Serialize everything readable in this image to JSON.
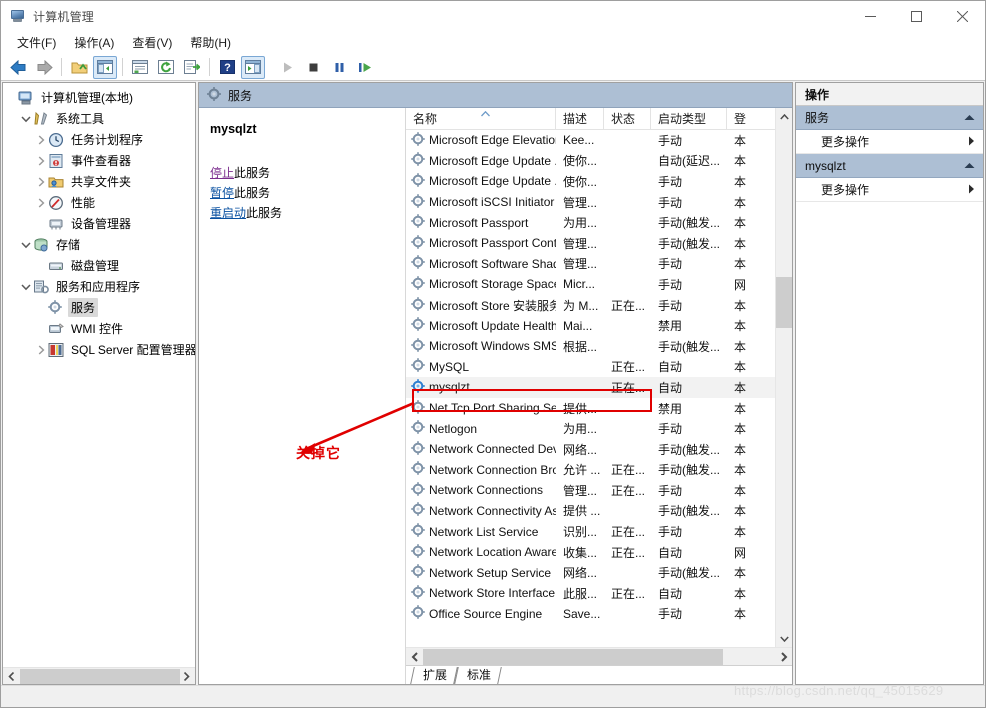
{
  "window": {
    "title": "计算机管理",
    "icon": "computer-management-icon",
    "minimize_label": "最小化",
    "maximize_label": "最大化",
    "close_label": "关闭"
  },
  "menubar": {
    "items": [
      {
        "label": "文件(F)",
        "name": "menu-file"
      },
      {
        "label": "操作(A)",
        "name": "menu-action"
      },
      {
        "label": "查看(V)",
        "name": "menu-view"
      },
      {
        "label": "帮助(H)",
        "name": "menu-help"
      }
    ]
  },
  "toolbar": {
    "buttons": [
      {
        "name": "back-button",
        "icon": "arrow-left-icon",
        "active": false
      },
      {
        "name": "forward-button",
        "icon": "arrow-right-icon",
        "active": false
      },
      {
        "name": "up-one-level-button",
        "icon": "folder-up-icon",
        "active": false
      },
      {
        "name": "show-hide-tree-button",
        "icon": "tree-pane-icon",
        "active": true
      },
      {
        "name": "properties-button",
        "icon": "properties-icon",
        "active": false
      },
      {
        "name": "refresh-button",
        "icon": "refresh-icon",
        "active": false
      },
      {
        "name": "export-list-button",
        "icon": "export-list-icon",
        "active": false
      },
      {
        "name": "help-button",
        "icon": "question-mark-icon",
        "active": false
      },
      {
        "name": "show-action-pane-button",
        "icon": "action-pane-icon",
        "active": true
      },
      {
        "name": "start-service-button",
        "icon": "play-icon",
        "active": false
      },
      {
        "name": "stop-service-button",
        "icon": "stop-icon",
        "active": false
      },
      {
        "name": "pause-service-button",
        "icon": "pause-icon",
        "active": false
      },
      {
        "name": "restart-service-button",
        "icon": "restart-icon",
        "active": false
      }
    ]
  },
  "tree": {
    "items": [
      {
        "label": "计算机管理(本地)",
        "depth": 0,
        "twisty": "none",
        "icon": "computer-icon",
        "selected": false
      },
      {
        "label": "系统工具",
        "depth": 1,
        "twisty": "expanded",
        "icon": "tools-icon",
        "selected": false
      },
      {
        "label": "任务计划程序",
        "depth": 2,
        "twisty": "collapsed",
        "icon": "clock-icon",
        "selected": false
      },
      {
        "label": "事件查看器",
        "depth": 2,
        "twisty": "collapsed",
        "icon": "event-viewer-icon",
        "selected": false
      },
      {
        "label": "共享文件夹",
        "depth": 2,
        "twisty": "collapsed",
        "icon": "shared-folder-icon",
        "selected": false
      },
      {
        "label": "性能",
        "depth": 2,
        "twisty": "collapsed",
        "icon": "performance-icon",
        "selected": false
      },
      {
        "label": "设备管理器",
        "depth": 2,
        "twisty": "none",
        "icon": "device-manager-icon",
        "selected": false
      },
      {
        "label": "存储",
        "depth": 1,
        "twisty": "expanded",
        "icon": "storage-icon",
        "selected": false
      },
      {
        "label": "磁盘管理",
        "depth": 2,
        "twisty": "none",
        "icon": "disk-management-icon",
        "selected": false
      },
      {
        "label": "服务和应用程序",
        "depth": 1,
        "twisty": "expanded",
        "icon": "services-apps-icon",
        "selected": false
      },
      {
        "label": "服务",
        "depth": 2,
        "twisty": "none",
        "icon": "gear-icon",
        "selected": true
      },
      {
        "label": "WMI 控件",
        "depth": 2,
        "twisty": "none",
        "icon": "wmi-control-icon",
        "selected": false
      },
      {
        "label": "SQL Server 配置管理器",
        "depth": 2,
        "twisty": "collapsed",
        "icon": "sql-server-icon",
        "selected": false
      }
    ]
  },
  "services_pane": {
    "banner_title": "服务",
    "banner_icon": "gear-icon",
    "detail": {
      "service_name": "mysqlzt",
      "links": [
        {
          "action": "停止",
          "suffix": "此服务",
          "visited": true,
          "name": "stop-service-link"
        },
        {
          "action": "暂停",
          "suffix": "此服务",
          "visited": false,
          "name": "pause-service-link"
        },
        {
          "action": "重启动",
          "suffix": "此服务",
          "visited": false,
          "name": "restart-service-link"
        }
      ]
    },
    "columns": [
      {
        "label": "名称",
        "name": "column-name",
        "sorted": true
      },
      {
        "label": "描述",
        "name": "column-description",
        "sorted": false
      },
      {
        "label": "状态",
        "name": "column-status",
        "sorted": false
      },
      {
        "label": "启动类型",
        "name": "column-startup-type",
        "sorted": false
      },
      {
        "label": "登",
        "name": "column-logon-as",
        "sorted": false
      }
    ],
    "sort_indicator": "^",
    "rows": [
      {
        "name": "Microsoft Edge Elevation...",
        "desc": "Kee...",
        "status": "",
        "startup": "手动",
        "logon": "本"
      },
      {
        "name": "Microsoft Edge Update ...",
        "desc": "使你...",
        "status": "",
        "startup": "自动(延迟...",
        "logon": "本"
      },
      {
        "name": "Microsoft Edge Update ...",
        "desc": "使你...",
        "status": "",
        "startup": "手动",
        "logon": "本"
      },
      {
        "name": "Microsoft iSCSI Initiator ...",
        "desc": "管理...",
        "status": "",
        "startup": "手动",
        "logon": "本"
      },
      {
        "name": "Microsoft Passport",
        "desc": "为用...",
        "status": "",
        "startup": "手动(触发...",
        "logon": "本"
      },
      {
        "name": "Microsoft Passport Cont...",
        "desc": "管理...",
        "status": "",
        "startup": "手动(触发...",
        "logon": "本"
      },
      {
        "name": "Microsoft Software Shad...",
        "desc": "管理...",
        "status": "",
        "startup": "手动",
        "logon": "本"
      },
      {
        "name": "Microsoft Storage Space...",
        "desc": "Micr...",
        "status": "",
        "startup": "手动",
        "logon": "网"
      },
      {
        "name": "Microsoft Store 安装服务",
        "desc": "为 M...",
        "status": "正在...",
        "startup": "手动",
        "logon": "本"
      },
      {
        "name": "Microsoft Update Health...",
        "desc": "Mai...",
        "status": "",
        "startup": "禁用",
        "logon": "本"
      },
      {
        "name": "Microsoft Windows SMS ...",
        "desc": "根据...",
        "status": "",
        "startup": "手动(触发...",
        "logon": "本"
      },
      {
        "name": "MySQL",
        "desc": "",
        "status": "正在...",
        "startup": "自动",
        "logon": "本"
      },
      {
        "name": "mysqlzt",
        "desc": "",
        "status": "正在...",
        "startup": "自动",
        "logon": "本",
        "selected": true
      },
      {
        "name": "Net.Tcp Port Sharing Ser...",
        "desc": "提供...",
        "status": "",
        "startup": "禁用",
        "logon": "本"
      },
      {
        "name": "Netlogon",
        "desc": "为用...",
        "status": "",
        "startup": "手动",
        "logon": "本"
      },
      {
        "name": "Network Connected Devi...",
        "desc": "网络...",
        "status": "",
        "startup": "手动(触发...",
        "logon": "本"
      },
      {
        "name": "Network Connection Bro...",
        "desc": "允许 ...",
        "status": "正在...",
        "startup": "手动(触发...",
        "logon": "本"
      },
      {
        "name": "Network Connections",
        "desc": "管理...",
        "status": "正在...",
        "startup": "手动",
        "logon": "本"
      },
      {
        "name": "Network Connectivity Ass...",
        "desc": "提供 ...",
        "status": "",
        "startup": "手动(触发...",
        "logon": "本"
      },
      {
        "name": "Network List Service",
        "desc": "识别...",
        "status": "正在...",
        "startup": "手动",
        "logon": "本"
      },
      {
        "name": "Network Location Aware...",
        "desc": "收集...",
        "status": "正在...",
        "startup": "自动",
        "logon": "网"
      },
      {
        "name": "Network Setup Service",
        "desc": "网络...",
        "status": "",
        "startup": "手动(触发...",
        "logon": "本"
      },
      {
        "name": "Network Store Interface ...",
        "desc": "此服...",
        "status": "正在...",
        "startup": "自动",
        "logon": "本"
      },
      {
        "name": "Office  Source Engine",
        "desc": "Save...",
        "status": "",
        "startup": "手动",
        "logon": "本"
      }
    ],
    "tabs": [
      {
        "label": "扩展",
        "name": "tab-extended",
        "active": false
      },
      {
        "label": "标准",
        "name": "tab-standard",
        "active": true
      }
    ]
  },
  "actions_pane": {
    "title": "操作",
    "groups": [
      {
        "header": "服务",
        "header_name": "actions-group-services",
        "items": [
          {
            "label": "更多操作",
            "name": "more-actions-services"
          }
        ]
      },
      {
        "header": "mysqlzt",
        "header_name": "actions-group-mysqlzt",
        "items": [
          {
            "label": "更多操作",
            "name": "more-actions-mysqlzt"
          }
        ]
      }
    ]
  },
  "annotation": {
    "text": "关掉它",
    "color": "#e00000"
  },
  "watermark": {
    "text": "https://blog.csdn.net/qq_45015629"
  },
  "colors": {
    "banner": "#adbfd4",
    "accent_link": "#0a51a1",
    "visited_link": "#7b2d8e",
    "annotation": "#e00000"
  }
}
